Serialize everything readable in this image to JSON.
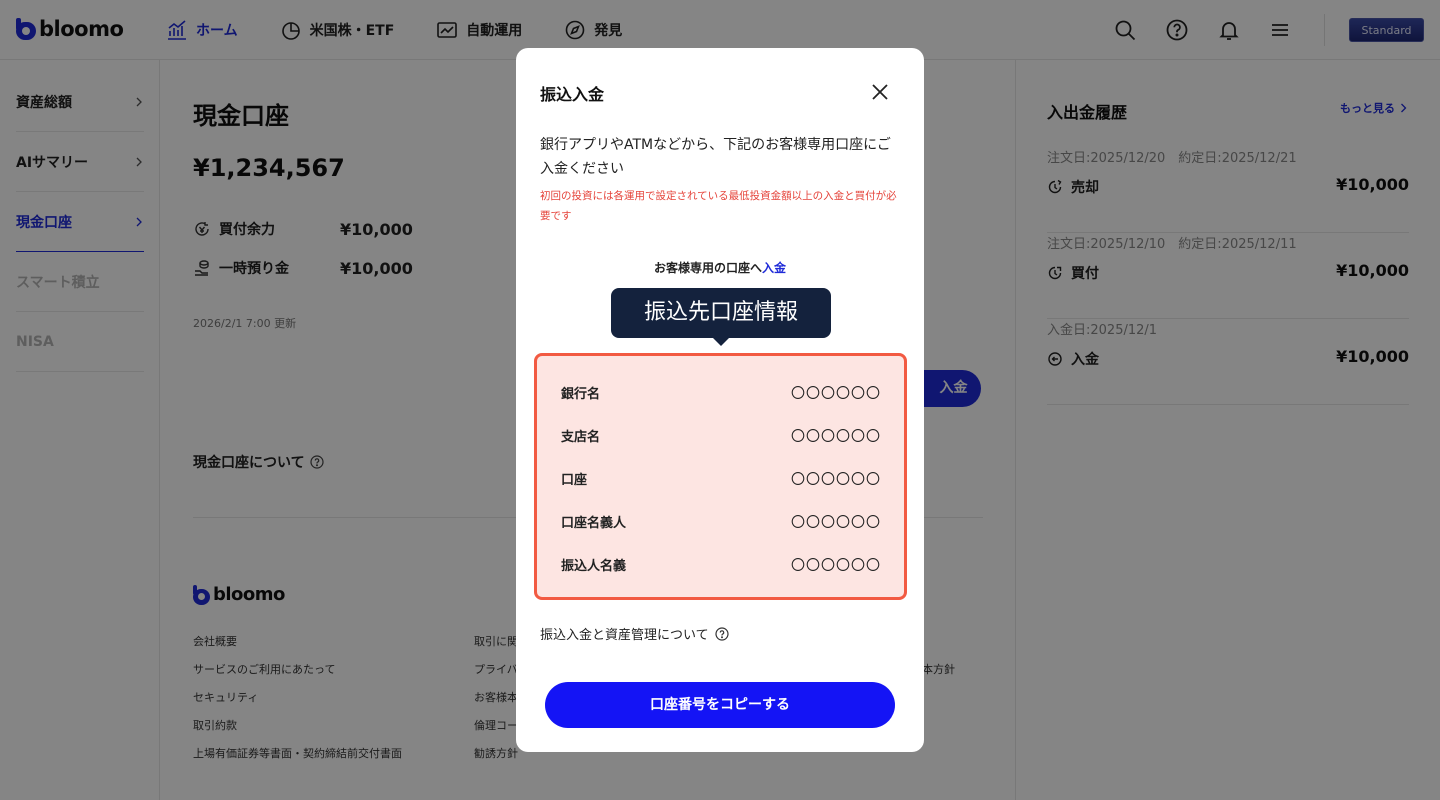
{
  "header": {
    "logo_text": "bloomo",
    "nav": [
      {
        "label": "ホーム",
        "icon": "home-chart-icon"
      },
      {
        "label": "米国株・ETF",
        "icon": "pie-chart-icon"
      },
      {
        "label": "自動運用",
        "icon": "line-chart-icon"
      },
      {
        "label": "発見",
        "icon": "compass-icon"
      }
    ],
    "icons": [
      "search-icon",
      "help-icon",
      "bell-icon",
      "menu-icon"
    ],
    "plan_badge": "Standard",
    "accent_color": "#1f2bd8"
  },
  "sidebar": {
    "items": [
      {
        "label": "資産総額"
      },
      {
        "label": "AIサマリー"
      },
      {
        "label": "現金口座"
      },
      {
        "label": "スマート積立"
      },
      {
        "label": "NISA"
      }
    ]
  },
  "main": {
    "title": "現金口座",
    "amount": "¥1,234,567",
    "stats": [
      {
        "label": "買付余力",
        "value": "¥10,000",
        "icon": "buying-power-icon"
      },
      {
        "label": "一時預り金",
        "value": "¥10,000",
        "icon": "coins-icon"
      }
    ],
    "updated": "2026/2/1 7:00 更新",
    "deposit_button": "入金",
    "about_cash": "現金口座について",
    "footer": {
      "logo_text": "bloomo",
      "links_col1": [
        "会社概要",
        "サービスのご利用にあたって",
        "セキュリティ",
        "取引約款",
        "上場有価証券等書面・契約締結前交付書面"
      ],
      "links_col2": [
        "取引に関",
        "プライバ",
        "お客様本",
        "倫理コー",
        "勧誘方針"
      ],
      "links_col3": [
        "本方針"
      ]
    }
  },
  "history": {
    "title": "入出金履歴",
    "more": "もっと見る",
    "items": [
      {
        "date": "注文日:2025/12/20　約定日:2025/12/21",
        "kind": "売却",
        "amount": "¥10,000",
        "icon": "sell-icon"
      },
      {
        "date": "注文日:2025/12/10　約定日:2025/12/11",
        "kind": "買付",
        "amount": "¥10,000",
        "icon": "buy-icon"
      },
      {
        "date": "入金日:2025/12/1",
        "kind": "入金",
        "amount": "¥10,000",
        "icon": "deposit-icon"
      }
    ]
  },
  "modal": {
    "title": "振込入金",
    "description": "銀行アプリやATMなどから、下記のお客様専用口座にご入金ください",
    "warning": "初回の投資には各運用で設定されている最低投資金額以上の入金と買付が必要です",
    "sub_prefix": "お客様専用の口座へ",
    "sub_link": "入金",
    "tooltip": "振込先口座情報",
    "rows": [
      {
        "label": "銀行名",
        "value": "〇〇〇〇〇〇"
      },
      {
        "label": "支店名",
        "value": "〇〇〇〇〇〇"
      },
      {
        "label": "口座",
        "value": "〇〇〇〇〇〇"
      },
      {
        "label": "口座名義人",
        "value": "〇〇〇〇〇〇"
      },
      {
        "label": "振込人名義",
        "value": "〇〇〇〇〇〇"
      }
    ],
    "about": "振込入金と資産管理について",
    "copy_button": "口座番号をコピーする",
    "highlight_color": "#f25a42",
    "button_color": "#1414f5"
  }
}
